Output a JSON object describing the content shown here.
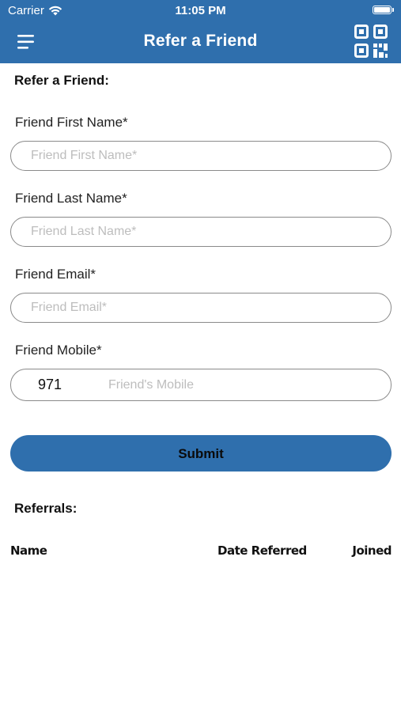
{
  "status_bar": {
    "carrier": "Carrier",
    "time": "11:05 PM"
  },
  "navbar": {
    "title": "Refer a Friend",
    "menu_icon": "hamburger-menu-icon",
    "qr_icon": "qr-code-icon"
  },
  "form": {
    "section_title": "Refer a Friend:",
    "first_name": {
      "label": "Friend First Name*",
      "placeholder": "Friend First Name*",
      "value": ""
    },
    "last_name": {
      "label": "Friend Last Name*",
      "placeholder": "Friend Last Name*",
      "value": ""
    },
    "email": {
      "label": "Friend Email*",
      "placeholder": "Friend Email*",
      "value": ""
    },
    "mobile": {
      "label": "Friend Mobile*",
      "country_code": "971",
      "placeholder": "Friend's Mobile",
      "value": ""
    },
    "submit_label": "Submit"
  },
  "referrals": {
    "section_title": "Referrals:",
    "columns": [
      "Name",
      "Date Referred",
      "Joined"
    ],
    "rows": []
  },
  "colors": {
    "brand": "#2f6fad",
    "border": "#8a8a8a",
    "placeholder": "#bdbdbd"
  }
}
